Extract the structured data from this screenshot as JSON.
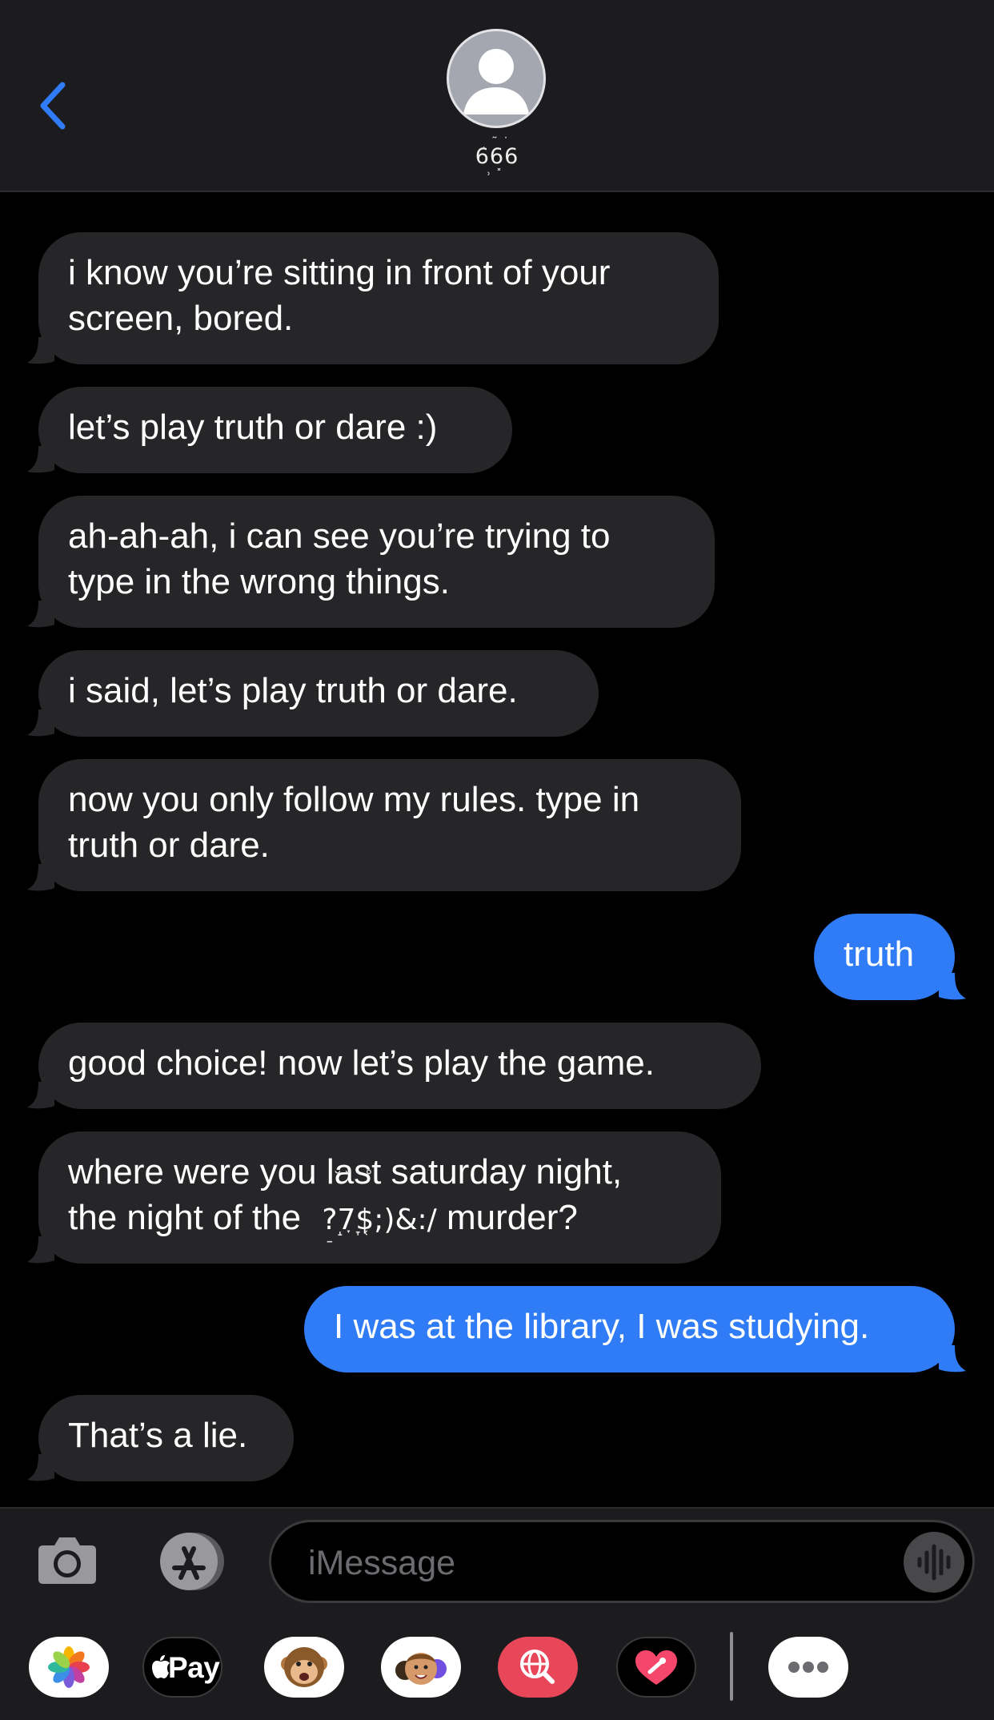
{
  "header": {
    "contact_name": "666",
    "contact_name_glitch_top": "¸˜˙",
    "contact_name_glitch_bottom": "˒˟"
  },
  "messages": [
    {
      "dir": "in",
      "lines": [
        "i know you’re sitting in front of your",
        "screen, bored."
      ]
    },
    {
      "dir": "in",
      "lines": [
        "let’s play truth or dare :)"
      ]
    },
    {
      "dir": "in",
      "lines": [
        "ah-ah-ah, i can see you’re trying to",
        "type in the wrong things."
      ]
    },
    {
      "dir": "in",
      "lines": [
        "i said, let’s play truth or dare."
      ]
    },
    {
      "dir": "in",
      "lines": [
        "now you only follow my rules. type in",
        "truth or dare."
      ]
    },
    {
      "dir": "out",
      "lines": [
        "truth"
      ]
    },
    {
      "dir": "in",
      "lines": [
        "good choice! now let’s play the game."
      ]
    },
    {
      "dir": "in",
      "lines": [
        "where were you last saturday night,",
        "the night of the"
      ],
      "glitch_text": "?7$;)&:/",
      "after_glitch": " murder?"
    },
    {
      "dir": "out",
      "lines": [
        "I was at the library, I was studying."
      ]
    },
    {
      "dir": "in",
      "lines": [
        "That’s a lie."
      ]
    }
  ],
  "input": {
    "placeholder": "iMessage"
  },
  "app_drawer": {
    "items": [
      "photos",
      "apple-pay",
      "animoji",
      "memoji",
      "search-web",
      "digital-touch",
      "more"
    ],
    "pay_label": "Pay"
  },
  "colors": {
    "accent": "#2f7cf6",
    "incoming_bubble": "#262628",
    "outgoing_bubble": "#2f7cf6",
    "header_bg": "#1c1c1e"
  }
}
